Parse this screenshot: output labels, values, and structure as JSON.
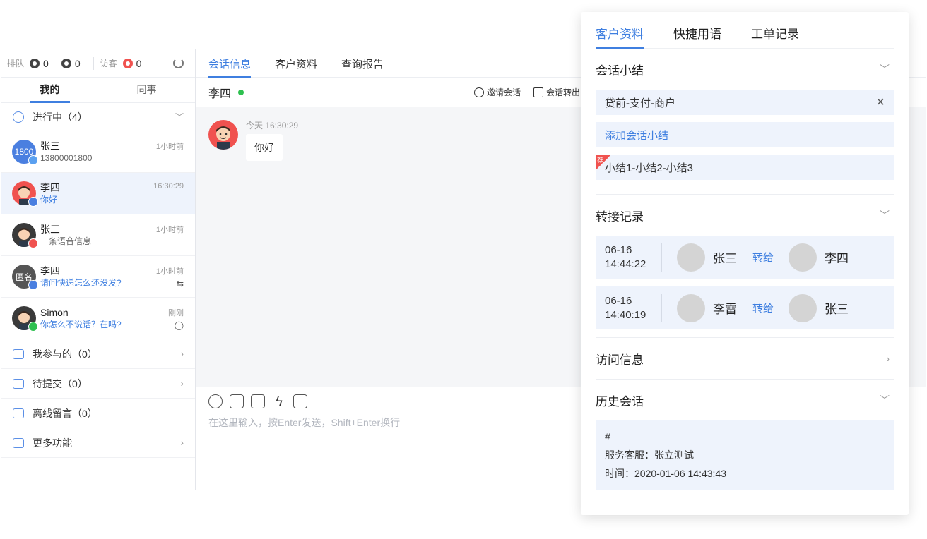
{
  "queue": {
    "queue_label": "排队",
    "queue_count": "0",
    "msg_count": "0",
    "visitor_label": "访客",
    "visitor_count": "0"
  },
  "left_tabs": [
    "我的",
    "同事"
  ],
  "in_progress": {
    "label": "进行中（4）"
  },
  "conversations": [
    {
      "name": "张三",
      "sub": "13800001800",
      "time": "1小时前",
      "avatar_text": "1800",
      "avatar_color": "#4a7fe0",
      "badge_color": "#5aa0f0",
      "sub_blue": false,
      "extra": ""
    },
    {
      "name": "李四",
      "sub": "你好",
      "time": "16:30:29",
      "avatar_text": "",
      "avatar_color": "#f0524f",
      "badge_color": "#4a7fe0",
      "sub_blue": true,
      "extra": ""
    },
    {
      "name": "张三",
      "sub": "一条语音信息",
      "time": "1小时前",
      "avatar_text": "",
      "avatar_color": "#3a3a3a",
      "badge_color": "#f0524f",
      "sub_blue": false,
      "extra": ""
    },
    {
      "name": "李四",
      "sub": "请问快递怎么还没发?",
      "time": "1小时前",
      "avatar_text": "匿名",
      "avatar_color": "#555555",
      "badge_color": "#4a7fe0",
      "sub_blue": true,
      "extra": "⇆"
    },
    {
      "name": "Simon",
      "sub": "你怎么不说话？在吗?",
      "time": "刚刚",
      "avatar_text": "",
      "avatar_color": "#3a3a3a",
      "badge_color": "#2ec04f",
      "sub_blue": true,
      "extra": "◯"
    }
  ],
  "menu": [
    {
      "label": "我参与的（0）",
      "chevron": "›"
    },
    {
      "label": "待提交（0）",
      "chevron": "›"
    },
    {
      "label": "离线留言（0）",
      "chevron": ""
    },
    {
      "label": "更多功能",
      "chevron": "›"
    }
  ],
  "center_tabs": [
    "会话信息",
    "客户资料",
    "查询报告"
  ],
  "chat": {
    "contact_name": "李四",
    "invite_label": "邀请会话",
    "transfer_label": "会话转出",
    "message_time": "今天 16:30:29",
    "message_text": "你好",
    "input_placeholder": "在这里输入，按Enter发送，Shift+Enter换行"
  },
  "panel": {
    "tabs": [
      "客户资料",
      "快捷用语",
      "工单记录"
    ],
    "summary_title": "会话小结",
    "summary_item": "贷前-支付-商户",
    "add_summary": "添加会话小结",
    "recommend_badge": "荐",
    "recommend_item": "小结1-小结2-小结3",
    "transfer_title": "转接记录",
    "transfers": [
      {
        "date": "06-16",
        "time": "14:44:22",
        "from": "张三",
        "action": "转给",
        "to": "李四"
      },
      {
        "date": "06-16",
        "time": "14:40:19",
        "from": "李雷",
        "action": "转给",
        "to": "张三"
      }
    ],
    "visit_title": "访问信息",
    "history_title": "历史会话",
    "history": {
      "line1": "#",
      "line2": "服务客服：张立测试",
      "line3": "时间：2020-01-06 14:43:43"
    }
  },
  "colors": {
    "accent": "#3f7fe0",
    "online": "#2ec04f",
    "highlight_bg": "#eef3fc"
  }
}
